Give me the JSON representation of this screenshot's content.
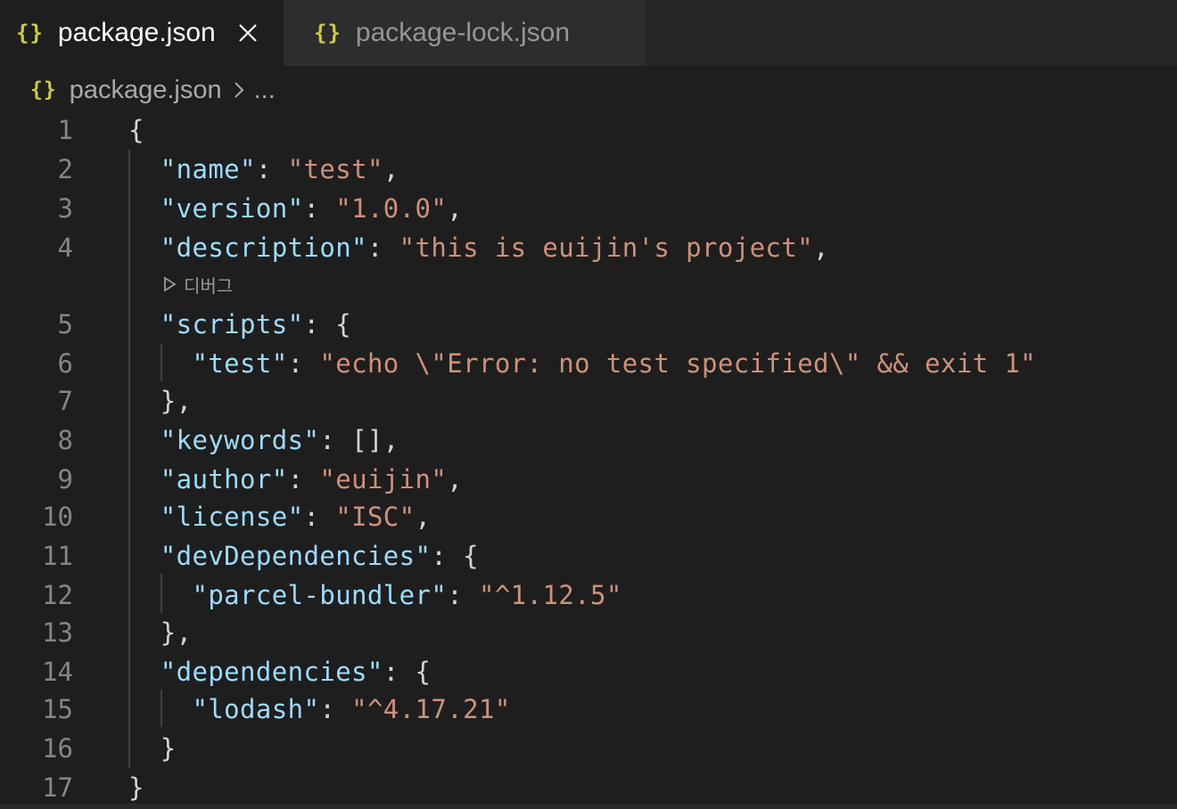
{
  "tabs": [
    {
      "label": "package.json",
      "icon": "json-braces-icon",
      "active": true
    },
    {
      "label": "package-lock.json",
      "icon": "json-braces-icon",
      "active": false
    }
  ],
  "icon_glyph": "{}",
  "breadcrumb": {
    "file": "package.json",
    "more": "..."
  },
  "codelens": {
    "label": "디버그"
  },
  "colors": {
    "key": "#9cdcfe",
    "string": "#ce9178",
    "punct": "#d4d4d4",
    "icon": "#cbcb41"
  },
  "lines": [
    {
      "n": "1",
      "parts": [
        {
          "t": "{",
          "c": "p"
        }
      ]
    },
    {
      "n": "2",
      "parts": [
        {
          "t": "  "
        },
        {
          "t": "\"name\"",
          "c": "k"
        },
        {
          "t": ": ",
          "c": "p"
        },
        {
          "t": "\"test\"",
          "c": "s"
        },
        {
          "t": ",",
          "c": "p"
        }
      ]
    },
    {
      "n": "3",
      "parts": [
        {
          "t": "  "
        },
        {
          "t": "\"version\"",
          "c": "k"
        },
        {
          "t": ": ",
          "c": "p"
        },
        {
          "t": "\"1.0.0\"",
          "c": "s"
        },
        {
          "t": ",",
          "c": "p"
        }
      ]
    },
    {
      "n": "4",
      "parts": [
        {
          "t": "  "
        },
        {
          "t": "\"description\"",
          "c": "k"
        },
        {
          "t": ": ",
          "c": "p"
        },
        {
          "t": "\"this is euijin's project\"",
          "c": "s"
        },
        {
          "t": ",",
          "c": "p"
        }
      ]
    },
    {
      "n": "5",
      "parts": [
        {
          "t": "  "
        },
        {
          "t": "\"scripts\"",
          "c": "k"
        },
        {
          "t": ": {",
          "c": "p"
        }
      ]
    },
    {
      "n": "6",
      "parts": [
        {
          "t": "    "
        },
        {
          "t": "\"test\"",
          "c": "k"
        },
        {
          "t": ": ",
          "c": "p"
        },
        {
          "t": "\"echo \\\"Error: no test specified\\\" && exit 1\"",
          "c": "s"
        }
      ]
    },
    {
      "n": "7",
      "parts": [
        {
          "t": "  "
        },
        {
          "t": "},",
          "c": "p"
        }
      ]
    },
    {
      "n": "8",
      "parts": [
        {
          "t": "  "
        },
        {
          "t": "\"keywords\"",
          "c": "k"
        },
        {
          "t": ": [],",
          "c": "p"
        }
      ]
    },
    {
      "n": "9",
      "parts": [
        {
          "t": "  "
        },
        {
          "t": "\"author\"",
          "c": "k"
        },
        {
          "t": ": ",
          "c": "p"
        },
        {
          "t": "\"euijin\"",
          "c": "s"
        },
        {
          "t": ",",
          "c": "p"
        }
      ]
    },
    {
      "n": "10",
      "parts": [
        {
          "t": "  "
        },
        {
          "t": "\"license\"",
          "c": "k"
        },
        {
          "t": ": ",
          "c": "p"
        },
        {
          "t": "\"ISC\"",
          "c": "s"
        },
        {
          "t": ",",
          "c": "p"
        }
      ]
    },
    {
      "n": "11",
      "parts": [
        {
          "t": "  "
        },
        {
          "t": "\"devDependencies\"",
          "c": "k"
        },
        {
          "t": ": {",
          "c": "p"
        }
      ]
    },
    {
      "n": "12",
      "parts": [
        {
          "t": "    "
        },
        {
          "t": "\"parcel-bundler\"",
          "c": "k"
        },
        {
          "t": ": ",
          "c": "p"
        },
        {
          "t": "\"^1.12.5\"",
          "c": "s"
        }
      ]
    },
    {
      "n": "13",
      "parts": [
        {
          "t": "  "
        },
        {
          "t": "},",
          "c": "p"
        }
      ]
    },
    {
      "n": "14",
      "parts": [
        {
          "t": "  "
        },
        {
          "t": "\"dependencies\"",
          "c": "k"
        },
        {
          "t": ": {",
          "c": "p"
        }
      ]
    },
    {
      "n": "15",
      "parts": [
        {
          "t": "    "
        },
        {
          "t": "\"lodash\"",
          "c": "k"
        },
        {
          "t": ": ",
          "c": "p"
        },
        {
          "t": "\"^4.17.21\"",
          "c": "s"
        }
      ]
    },
    {
      "n": "16",
      "parts": [
        {
          "t": "  "
        },
        {
          "t": "}",
          "c": "p"
        }
      ]
    },
    {
      "n": "17",
      "parts": [
        {
          "t": "}",
          "c": "p"
        }
      ]
    }
  ]
}
